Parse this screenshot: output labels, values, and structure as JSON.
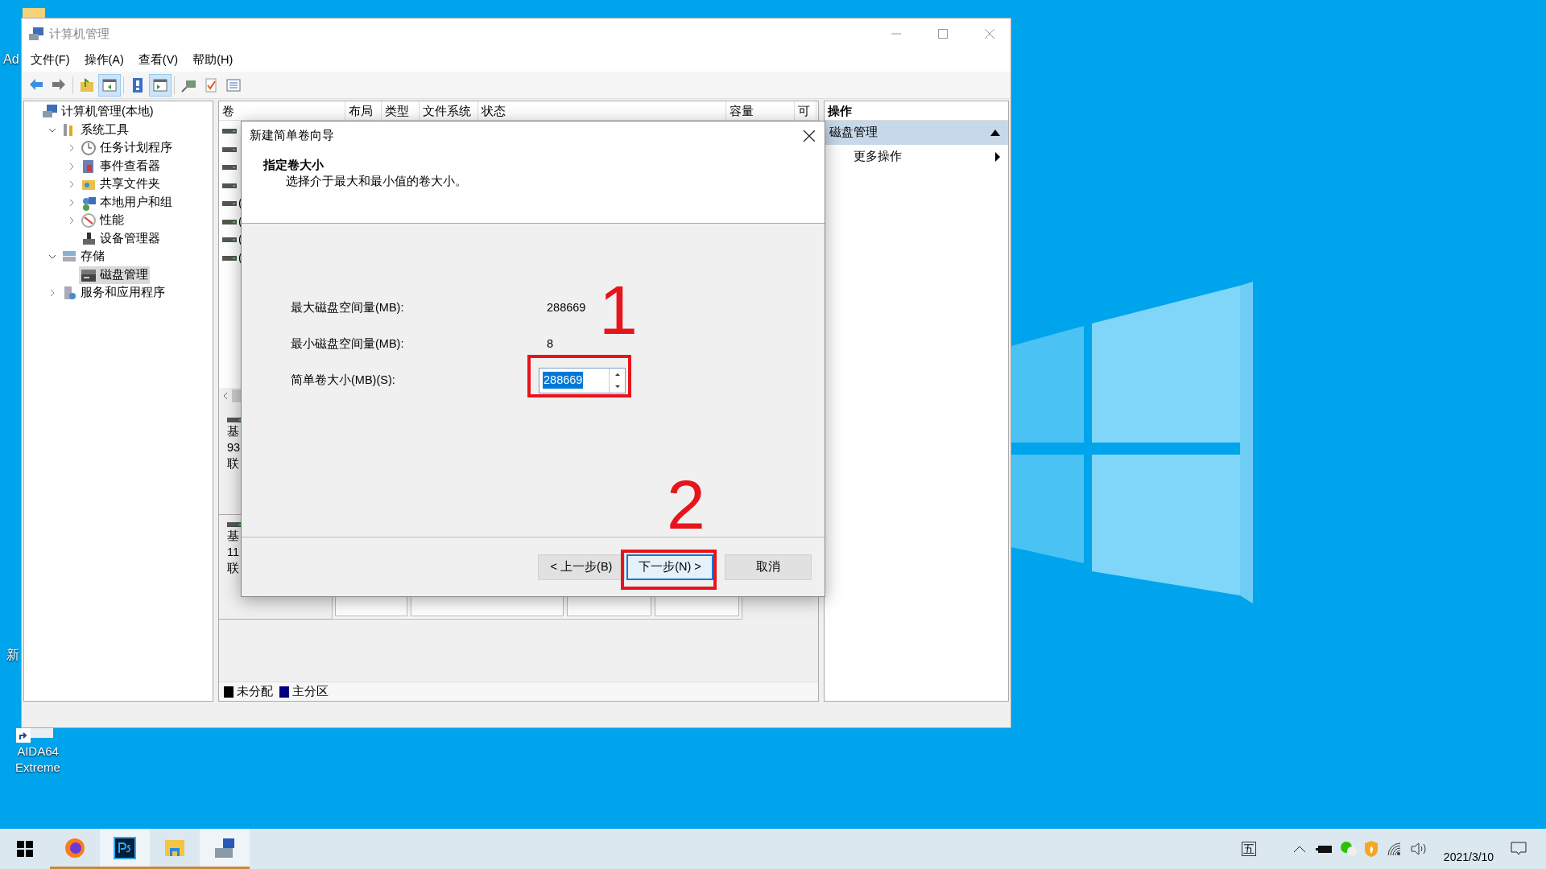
{
  "desktop": {
    "icons": [
      {
        "label": "Ad"
      },
      {
        "label": "新"
      },
      {
        "label": "AIDA64 Extreme"
      }
    ]
  },
  "window": {
    "title": "计算机管理",
    "menu": [
      "文件(F)",
      "操作(A)",
      "查看(V)",
      "帮助(H)"
    ],
    "toolbar": [
      {
        "pressed": false
      },
      {
        "pressed": false
      },
      {
        "pressed": false
      },
      {
        "pressed": true
      },
      {
        "pressed": false
      },
      {
        "pressed": true
      },
      {
        "pressed": false
      },
      {
        "pressed": false
      },
      {
        "pressed": false
      }
    ],
    "tree": [
      {
        "label": "计算机管理(本地)",
        "selected": false,
        "children": [
          {
            "label": "系统工具",
            "selected": false,
            "expanded": true,
            "children": [
              {
                "label": "任务计划程序",
                "selected": false,
                "expanded": false
              },
              {
                "label": "事件查看器",
                "selected": false,
                "expanded": false
              },
              {
                "label": "共享文件夹",
                "selected": false,
                "expanded": false
              },
              {
                "label": "本地用户和组",
                "selected": false,
                "expanded": false
              },
              {
                "label": "性能",
                "selected": false,
                "expanded": false
              },
              {
                "label": "设备管理器",
                "selected": false
              }
            ]
          },
          {
            "label": "存储",
            "selected": false,
            "expanded": true,
            "children": [
              {
                "label": "磁盘管理",
                "selected": true
              }
            ]
          },
          {
            "label": "服务和应用程序",
            "selected": false,
            "expanded": false
          }
        ]
      }
    ],
    "volume_list": {
      "columns": [
        "卷",
        "布局",
        "类型",
        "文件系统",
        "状态",
        "容量",
        "可"
      ],
      "rows": [
        {
          "kind": "disk"
        },
        {
          "kind": "disk"
        },
        {
          "kind": "disk"
        },
        {
          "kind": "disk"
        },
        {
          "kind": "disk",
          "text": "("
        },
        {
          "kind": "disk",
          "text": "("
        },
        {
          "kind": "disk",
          "text": "("
        },
        {
          "kind": "disk",
          "text": "("
        }
      ]
    },
    "disks": [
      {
        "lines": [
          "基",
          "93",
          "联"
        ]
      },
      {
        "lines": [
          "基",
          "11",
          "联"
        ]
      }
    ],
    "legend": [
      {
        "label": "未分配",
        "color": "#000000"
      },
      {
        "label": "主分区",
        "color": "#000080"
      }
    ],
    "actions": {
      "title": "操作",
      "items": [
        {
          "label": "磁盘管理",
          "selected": true
        },
        {
          "label": "更多操作",
          "selected": false
        }
      ]
    }
  },
  "dialog": {
    "title": "新建简单卷向导",
    "heading": "指定卷大小",
    "subtitle": "选择介于最大和最小值的卷大小。",
    "fields": [
      {
        "kind": "text",
        "label": "最大磁盘空间量(MB):",
        "value": "288669"
      },
      {
        "kind": "text",
        "label": "最小磁盘空间量(MB):",
        "value": "8"
      },
      {
        "kind": "spinner",
        "label": "简单卷大小(MB)(S):",
        "value": "288669"
      }
    ],
    "buttons": [
      {
        "label": "< 上一步(B)",
        "focused": false
      },
      {
        "label": "下一步(N) >",
        "focused": true
      },
      {
        "label": "取消",
        "focused": false
      }
    ]
  },
  "annotations": [
    {
      "label": "1"
    },
    {
      "label": "2"
    }
  ],
  "taskbar": {
    "apps": [
      {
        "running": true,
        "highlighted": false
      },
      {
        "running": true,
        "highlighted": true
      },
      {
        "running": true,
        "highlighted": false
      },
      {
        "running": true,
        "highlighted": true
      }
    ],
    "ime": "五",
    "date": "2021/3/10"
  }
}
